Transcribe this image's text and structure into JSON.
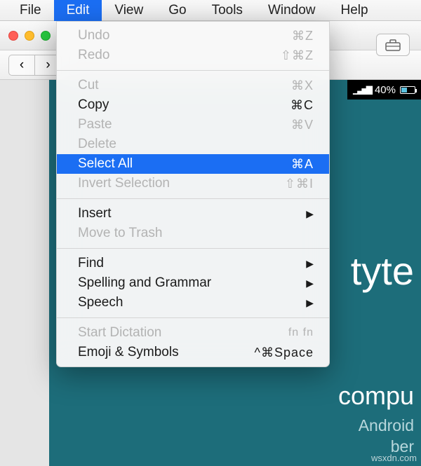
{
  "menubar": {
    "items": [
      {
        "label": "File"
      },
      {
        "label": "Edit",
        "active": true
      },
      {
        "label": "View"
      },
      {
        "label": "Go"
      },
      {
        "label": "Tools"
      },
      {
        "label": "Window"
      },
      {
        "label": "Help"
      }
    ]
  },
  "dropdown": {
    "undo": {
      "label": "Undo",
      "shortcut": "⌘Z"
    },
    "redo": {
      "label": "Redo",
      "shortcut": "⇧⌘Z"
    },
    "cut": {
      "label": "Cut",
      "shortcut": "⌘X"
    },
    "copy": {
      "label": "Copy",
      "shortcut": "⌘C"
    },
    "paste": {
      "label": "Paste",
      "shortcut": "⌘V"
    },
    "delete": {
      "label": "Delete",
      "shortcut": ""
    },
    "select_all": {
      "label": "Select All",
      "shortcut": "⌘A"
    },
    "invert_selection": {
      "label": "Invert Selection",
      "shortcut": "⇧⌘I"
    },
    "insert": {
      "label": "Insert"
    },
    "move_to_trash": {
      "label": "Move to Trash"
    },
    "find": {
      "label": "Find"
    },
    "spelling": {
      "label": "Spelling and Grammar"
    },
    "speech": {
      "label": "Speech"
    },
    "dictation": {
      "label": "Start Dictation",
      "shortcut": "fn fn"
    },
    "emoji": {
      "label": "Emoji & Symbols",
      "shortcut": "^⌘Space"
    }
  },
  "status": {
    "battery_pct": "40%"
  },
  "page": {
    "frag1": "tyte",
    "frag2": "compu",
    "frag3": "Android",
    "frag4": "ber"
  },
  "watermark": "wsxdn.com"
}
